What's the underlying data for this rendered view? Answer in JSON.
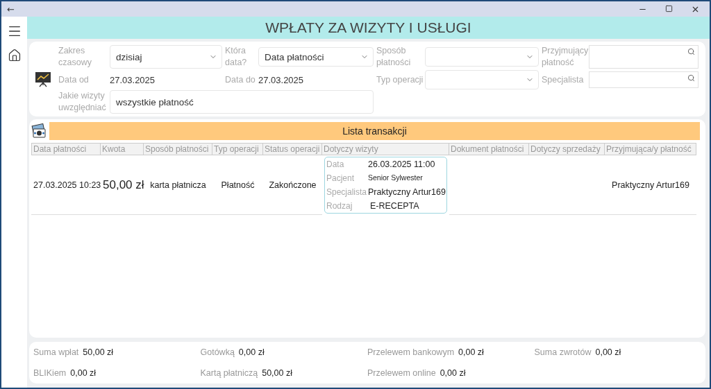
{
  "window": {
    "back": "←"
  },
  "header": {
    "title": "WPŁATY ZA WIZYTY I USŁUGI"
  },
  "filters": {
    "range": {
      "label": "Zakres czasowy",
      "value": "dzisiaj"
    },
    "which_date": {
      "label": "Która data?",
      "value": "Data płatności"
    },
    "method": {
      "label": "Sposób płatności"
    },
    "receiver": {
      "label": "Przyjmujący płatność"
    },
    "date_from": {
      "label": "Data od",
      "value": "27.03.2025"
    },
    "date_to": {
      "label": "Data do",
      "value": "27.03.2025"
    },
    "operation_type": {
      "label": "Typ operacji"
    },
    "specialist": {
      "label": "Specjalista"
    },
    "visits": {
      "label": "Jakie wizyty uwzględniać",
      "value": "wszystkie płatność"
    }
  },
  "transactions": {
    "title": "Lista transakcji",
    "columns": [
      "Data płatności",
      "Kwota",
      "Sposób płatności",
      "Typ operacji",
      "Status operacji",
      "Dotyczy wizyty",
      "Dokument płatności",
      "Dotyczy sprzedaży",
      "Przyjmująca/y płatność"
    ],
    "rows": [
      {
        "date": "27.03.2025 10:23",
        "amount": "50,00 zł",
        "method": "karta płatnicza",
        "type": "Płatność",
        "status": "Zakończone",
        "visit": [
          {
            "label": "Data",
            "value": "26.03.2025 11:00",
            "kind": "normal"
          },
          {
            "label": "Pacjent",
            "value": "Senior Sylwester",
            "kind": "small"
          },
          {
            "label": "Specjalista",
            "value": "Praktyczny  Artur169",
            "kind": "normal"
          },
          {
            "label": "Rodzaj",
            "value": "E-RECEPTA",
            "kind": "indent"
          }
        ],
        "receiver": "Praktyczny  Artur169"
      }
    ]
  },
  "summary": [
    {
      "label": "Suma wpłat",
      "value": "50,00 zł"
    },
    {
      "label": "Gotówką",
      "value": "0,00 zł"
    },
    {
      "label": "Przelewem bankowym",
      "value": "0,00 zł"
    },
    {
      "label": "Suma zwrotów",
      "value": "0,00 zł"
    },
    {
      "label": "BLIKiem",
      "value": "0,00 zł"
    },
    {
      "label": "Kartą płatniczą",
      "value": "50,00 zł"
    },
    {
      "label": "Przelewem online",
      "value": "0,00 zł"
    }
  ]
}
